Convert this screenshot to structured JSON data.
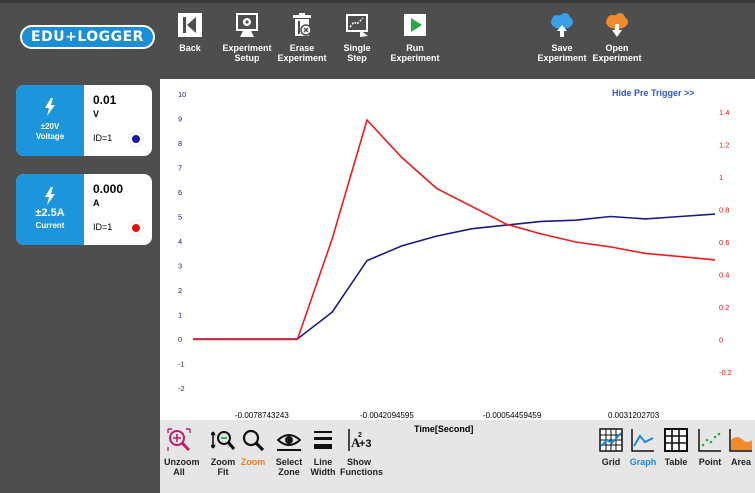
{
  "app": {
    "logo_text": "EDU+LOGGER"
  },
  "toolbar": {
    "back": "Back",
    "experiment_setup": [
      "Experiment",
      "Setup"
    ],
    "erase_experiment": [
      "Erase",
      "Experiment"
    ],
    "single_step": [
      "Single",
      "Step"
    ],
    "run_experiment": [
      "Run",
      "Experiment"
    ],
    "save_experiment": [
      "Save",
      "Experiment"
    ],
    "open_experiment": [
      "Open",
      "Experiment"
    ]
  },
  "sensors": [
    {
      "value": "0.01",
      "unit": "V",
      "range": "±20V",
      "name": "Voltage",
      "id": "ID=1",
      "color": "#1a1aa8"
    },
    {
      "value": "0.000",
      "unit": "A",
      "range": "±2.5A",
      "name": "Current",
      "id": "ID=1",
      "color": "#e01010"
    }
  ],
  "graph": {
    "hide_pre_trigger": "Hide Pre Trigger >>",
    "x_label": "Time[Second]",
    "x_ticks": [
      "-0.0078743243",
      "-0.0042094595",
      "-0.00054459459",
      "0.0031202703"
    ]
  },
  "chart_data": {
    "type": "line",
    "xlabel": "Time[Second]",
    "left_axis": {
      "ticks": [
        "10",
        "9",
        "8",
        "7",
        "6",
        "5",
        "4",
        "3",
        "2",
        "1",
        "0",
        "-1",
        "-2"
      ],
      "ylim": [
        -2,
        10
      ]
    },
    "right_axis": {
      "ticks": [
        "1.4",
        "1.2",
        "1",
        "0.8",
        "0.6",
        "0.4",
        "0.2",
        "0",
        "-0.2"
      ],
      "ylim": [
        -0.2,
        1.4
      ]
    },
    "series": [
      {
        "name": "Voltage",
        "color": "#1a1a8a",
        "axis": "left",
        "values": [
          0,
          0,
          0,
          0,
          1.1,
          3.2,
          3.8,
          4.2,
          4.5,
          4.65,
          4.8,
          4.85,
          5.0,
          4.9,
          5.0,
          5.1
        ]
      },
      {
        "name": "Current",
        "color": "#ee1c1c",
        "axis": "right",
        "values": [
          0,
          0,
          0,
          0,
          0.62,
          1.35,
          1.12,
          0.93,
          0.82,
          0.71,
          0.65,
          0.6,
          0.57,
          0.53,
          0.51,
          0.49
        ]
      }
    ],
    "x_index": [
      0,
      1,
      2,
      3,
      4,
      5,
      6,
      7,
      8,
      9,
      10,
      11,
      12,
      13,
      14,
      15
    ],
    "grid": false
  },
  "bottom_tools": {
    "unzoom_all": [
      "Unzoom",
      "All"
    ],
    "zoom_fit": [
      "Zoom",
      "Fit"
    ],
    "zoom": [
      "Zoom",
      ""
    ],
    "select_zone": [
      "Select",
      "Zone"
    ],
    "line_width": [
      "Line",
      "Width"
    ],
    "show_functions": [
      "Show",
      "Functions"
    ],
    "grid": "Grid",
    "graph": "Graph",
    "table": "Table",
    "point": "Point",
    "area": "Area"
  }
}
